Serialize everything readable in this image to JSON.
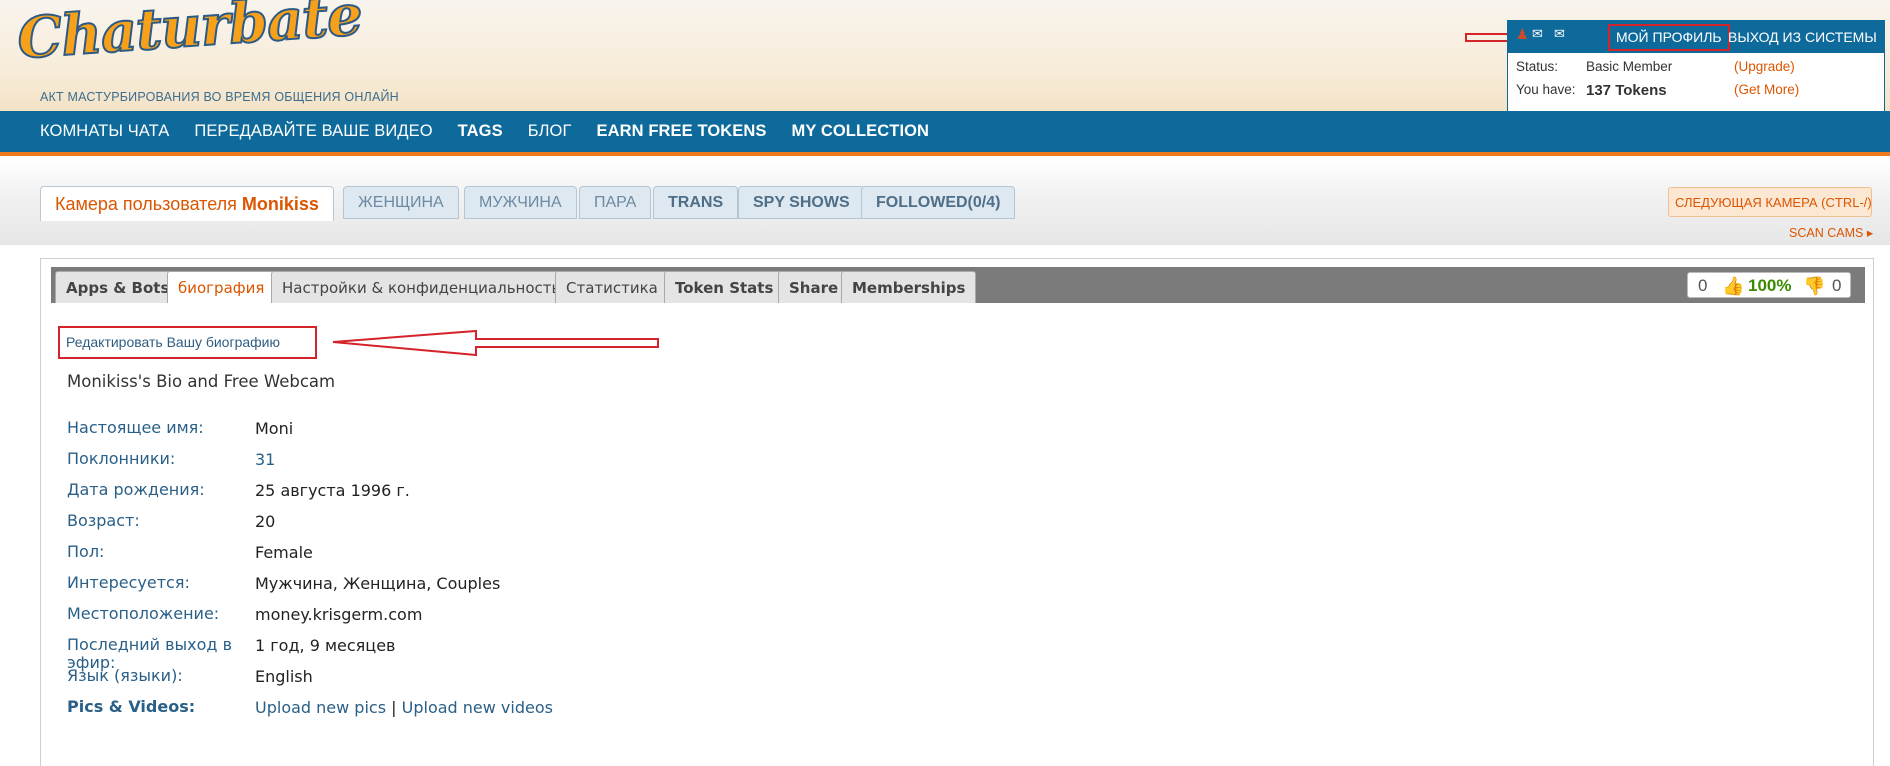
{
  "header": {
    "logo": "Chaturbate",
    "tagline": "АКТ МАСТУРБИРОВАНИЯ ВО ВРЕМЯ ОБЩЕНИЯ ОНЛАЙН",
    "my_profile": "МОЙ ПРОФИЛЬ",
    "logout": "ВЫХОД ИЗ СИСТЕМЫ",
    "status_label": "Status:",
    "status_value": "Basic Member",
    "upgrade": "(Upgrade)",
    "tokens_label": "You have:",
    "tokens_value": "137 Tokens",
    "get_more": "(Get More)"
  },
  "nav": {
    "items": [
      "КОМНАТЫ ЧАТА",
      "ПЕРЕДАВАЙТЕ ВАШЕ ВИДЕО",
      "TAGS",
      "БЛОГ",
      "EARN FREE TOKENS",
      "MY COLLECTION"
    ]
  },
  "subtabs": {
    "cam_prefix": "Камера пользователя",
    "cam_user": "Monikiss",
    "tabs": [
      "ЖЕНЩИНА",
      "МУЖЧИНА",
      "ПАРА",
      "TRANS",
      "SPY SHOWS",
      "FOLLOWED(0/4)"
    ],
    "next_cam": "СЛЕДУЮЩАЯ КАМЕРА (CTRL-/)",
    "scan_cams": "SCAN CAMS"
  },
  "panel": {
    "tabs": [
      "Apps & Bots",
      "биография",
      "Настройки & конфиденциальность",
      "Статистика",
      "Token Stats",
      "Share",
      "Memberships"
    ],
    "rating": {
      "up": "0",
      "percent": "100%",
      "down": "0"
    },
    "edit_bio": "Редактировать Вашу биографию",
    "bio_title": "Monikiss's Bio and Free Webcam",
    "fields": [
      {
        "key": "Настоящее имя:",
        "value": "Moni"
      },
      {
        "key": "Поклонники:",
        "value": "31"
      },
      {
        "key": "Дата рождения:",
        "value": "25 августа 1996 г."
      },
      {
        "key": "Возраст:",
        "value": "20"
      },
      {
        "key": "Пол:",
        "value": "Female"
      },
      {
        "key": "Интересуется:",
        "value": "Мужчина, Женщина, Couples"
      },
      {
        "key": "Местоположение:",
        "value": "money.krisgerm.com"
      },
      {
        "key": "Последний выход в эфир:",
        "value": "1 год, 9 месяцев"
      },
      {
        "key": "Язык (языки):",
        "value": "English"
      }
    ],
    "pics_label": "Pics & Videos:",
    "upload_pics": "Upload new pics",
    "separator": "|",
    "upload_videos": "Upload new videos"
  }
}
